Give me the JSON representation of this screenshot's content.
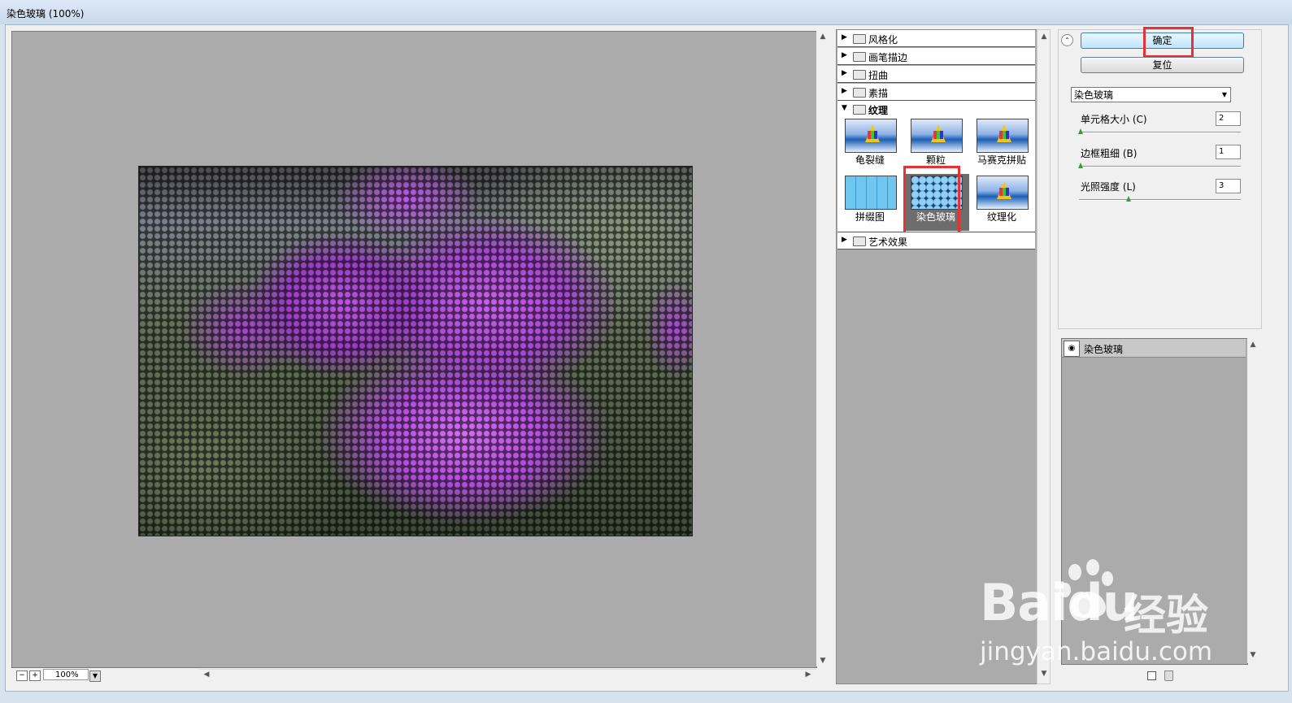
{
  "window": {
    "title": "染色玻璃 (100%)"
  },
  "preview": {
    "zoom": "100%"
  },
  "filter_categories": {
    "stylize": "风格化",
    "brush_strokes": "画笔描边",
    "distort": "扭曲",
    "sketch": "素描",
    "texture": "纹理",
    "artistic": "艺术效果"
  },
  "texture_filters": [
    "龟裂缝",
    "颗粒",
    "马赛克拼贴",
    "拼缀图",
    "染色玻璃",
    "纹理化"
  ],
  "selected_filter": "染色玻璃",
  "buttons": {
    "ok": "确定",
    "reset": "复位"
  },
  "filter_dropdown": {
    "value": "染色玻璃"
  },
  "parameters": [
    {
      "label": "单元格大小 (C)",
      "value": "2"
    },
    {
      "label": "边框粗细 (B)",
      "value": "1"
    },
    {
      "label": "光照强度 (L)",
      "value": "3"
    }
  ],
  "layers": {
    "item": "染色玻璃"
  },
  "watermark": {
    "brand": "Baidu",
    "cn": "经验",
    "url": "jingyan.baidu.com"
  },
  "colors": {
    "highlight": "#e53333",
    "selection": "#6d6d6d"
  }
}
